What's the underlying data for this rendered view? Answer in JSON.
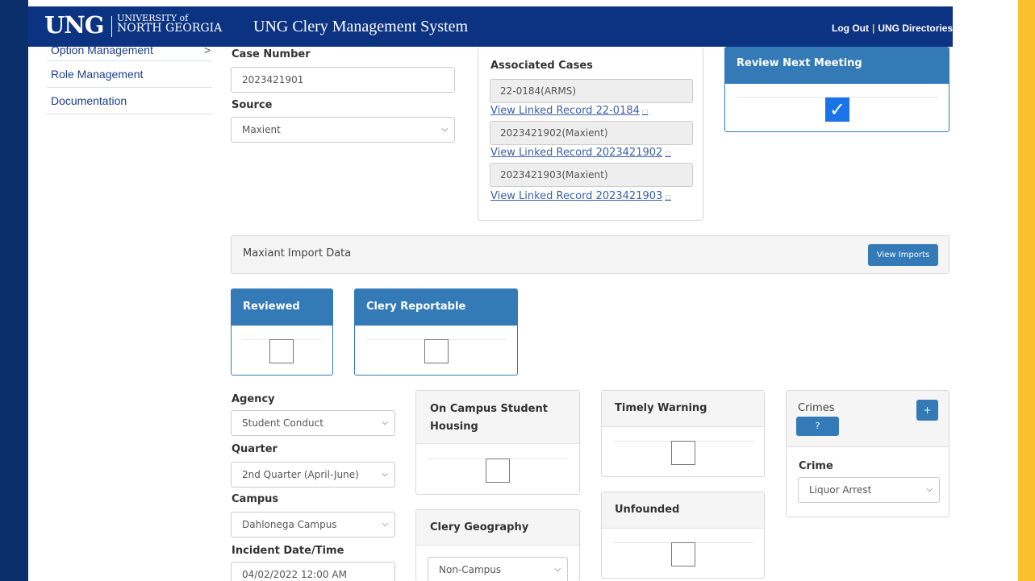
{
  "header": {
    "logo_abbr": "UNG",
    "logo_line1": "UNIVERSITY of",
    "logo_line2": "NORTH GEORGIA",
    "app_title": "UNG Clery Management System",
    "logout": "Log Out",
    "directories": "UNG Directories"
  },
  "sidebar": {
    "items": [
      {
        "label": "Option Management",
        "chevron": ">"
      },
      {
        "label": "Role Management"
      },
      {
        "label": "Documentation"
      }
    ]
  },
  "form": {
    "case_number_label": "Case Number",
    "case_number_value": "2023421901",
    "source_label": "Source",
    "source_value": "Maxient",
    "agency_label": "Agency",
    "agency_value": "Student Conduct",
    "quarter_label": "Quarter",
    "quarter_value": "2nd Quarter (April-June)",
    "campus_label": "Campus",
    "campus_value": "Dahlonega Campus",
    "incident_label": "Incident Date/Time",
    "incident_value": "04/02/2022 12:00 AM"
  },
  "associated": {
    "title": "Associated Cases",
    "cases": [
      {
        "field": "22-0184(ARMS)",
        "link": "View Linked Record 22-0184"
      },
      {
        "field": "2023421902(Maxient)",
        "link": "View Linked Record 2023421902"
      },
      {
        "field": "2023421903(Maxient)",
        "link": "View Linked Record 2023421903"
      }
    ]
  },
  "review_next": {
    "title": "Review Next Meeting",
    "checked": true
  },
  "import": {
    "title": "Maxiant Import Data",
    "button": "View Imports"
  },
  "reviewed": {
    "title": "Reviewed",
    "checked": false
  },
  "clery_reportable": {
    "title": "Clery Reportable",
    "checked": false
  },
  "on_campus": {
    "title": "On Campus Student Housing",
    "checked": false
  },
  "clery_geography": {
    "title": "Clery Geography",
    "value": "Non-Campus"
  },
  "timely_warning": {
    "title": "Timely Warning",
    "checked": false
  },
  "unfounded": {
    "title": "Unfounded",
    "checked": false
  },
  "crimes": {
    "title": "Crimes",
    "add_button": "+",
    "help_button": "?",
    "crime_label": "Crime",
    "crime_value": "Liquor Arrest"
  },
  "colors": {
    "navy": "#0c3382",
    "gold": "#f9c12e",
    "panel_blue": "#337ab7",
    "check_blue": "#1a73e8"
  },
  "icons": {
    "caret": "chevron-down-icon",
    "check": "checkmark-icon",
    "external": "external-link-icon"
  }
}
